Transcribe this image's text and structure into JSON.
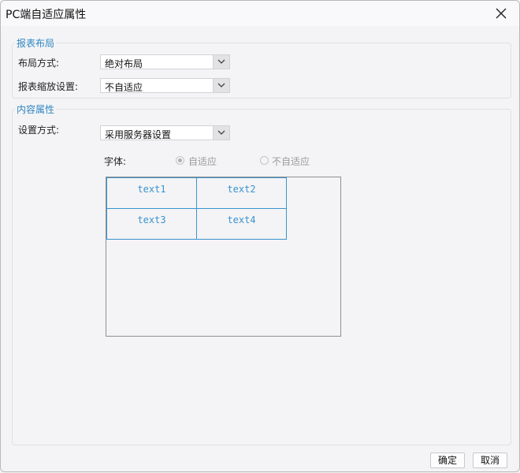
{
  "dialog": {
    "title": "PC端自适应属性",
    "close_icon": "close-icon"
  },
  "report_layout": {
    "legend": "报表布局",
    "layout_mode": {
      "label": "布局方式:",
      "value": "绝对布局"
    },
    "scale_setting": {
      "label": "报表缩放设置:",
      "value": "不自适应"
    }
  },
  "content_properties": {
    "legend": "内容属性",
    "setting_mode": {
      "label": "设置方式:",
      "value": "采用服务器设置"
    },
    "font": {
      "label": "字体:",
      "options": [
        {
          "label": "自适应",
          "selected": true
        },
        {
          "label": "不自适应",
          "selected": false
        }
      ]
    },
    "preview_cells": [
      "text1",
      "text2",
      "text3",
      "text4"
    ]
  },
  "footer": {
    "ok_label": "确定",
    "cancel_label": "取消"
  }
}
